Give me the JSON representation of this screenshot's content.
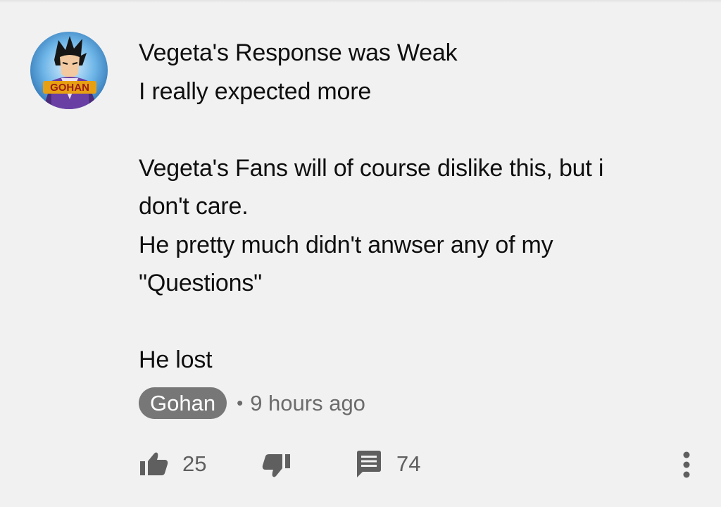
{
  "comment": {
    "lines": [
      "Vegeta's Response was Weak",
      "I really expected more",
      "",
      "Vegeta's Fans will of course dislike this, but i",
      "don't care.",
      "He pretty much didn't anwser any of my",
      "\"Questions\"",
      "",
      "He lost"
    ],
    "author": "Gohan",
    "separator": "•",
    "time": "9 hours ago",
    "avatar_badge": "GOHAN"
  },
  "actions": {
    "likes": "25",
    "replies": "74",
    "like_icon": "thumbs-up-icon",
    "dislike_icon": "thumbs-down-icon",
    "reply_icon": "comment-icon",
    "more_icon": "more-vert-icon"
  },
  "colors": {
    "background": "#f1f1f1",
    "text": "#0f0f0f",
    "secondary": "#6b6b6b",
    "chip": "#777777",
    "icon": "#5f5f5f"
  }
}
